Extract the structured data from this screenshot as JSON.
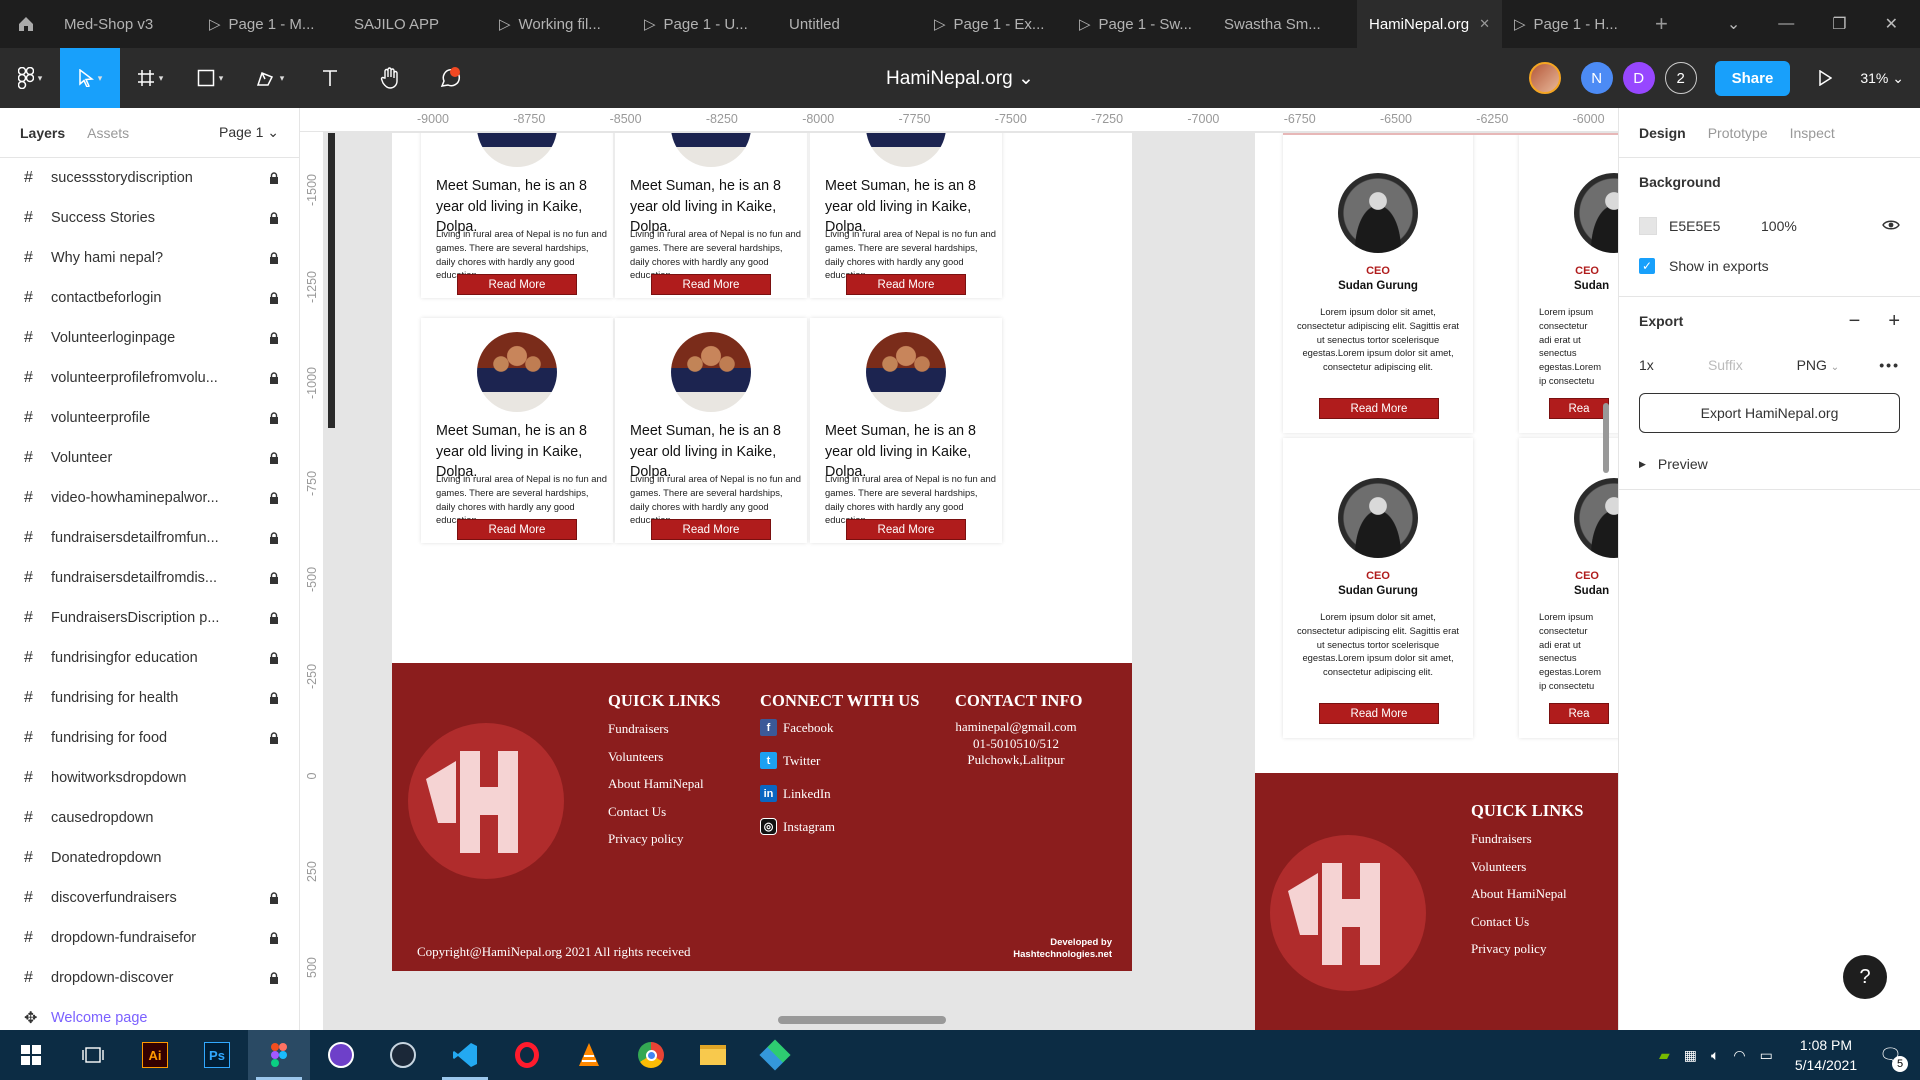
{
  "tabs": [
    {
      "label": "Med-Shop v3",
      "proto": false
    },
    {
      "label": "Page 1 - M...",
      "proto": true
    },
    {
      "label": "SAJILO APP",
      "proto": false
    },
    {
      "label": "Working fil...",
      "proto": true
    },
    {
      "label": "Page 1 - U...",
      "proto": true
    },
    {
      "label": "Untitled",
      "proto": false
    },
    {
      "label": "Page 1 - Ex...",
      "proto": true
    },
    {
      "label": "Page 1 - Sw...",
      "proto": true
    },
    {
      "label": "Swastha Sm...",
      "proto": false
    },
    {
      "label": "HamiNepal.org",
      "proto": false,
      "active": true
    },
    {
      "label": "Page 1 - H...",
      "proto": true
    }
  ],
  "file_title": "HamiNepal.org",
  "zoom": "31%",
  "collab_count": "2",
  "avatars": [
    {
      "letter": "N",
      "color": "#4c8bf5"
    },
    {
      "letter": "D",
      "color": "#9747ff"
    }
  ],
  "share_label": "Share",
  "left_panel": {
    "tab_layers": "Layers",
    "tab_assets": "Assets",
    "page": "Page 1"
  },
  "layers": [
    {
      "name": "sucessstorydiscription",
      "locked": true
    },
    {
      "name": "Success Stories",
      "locked": true
    },
    {
      "name": "Why hami nepal?",
      "locked": true
    },
    {
      "name": "contactbeforlogin",
      "locked": true
    },
    {
      "name": "Volunteerloginpage",
      "locked": true
    },
    {
      "name": "volunteerprofilefromvolu...",
      "locked": true
    },
    {
      "name": "volunteerprofile",
      "locked": true
    },
    {
      "name": "Volunteer",
      "locked": true
    },
    {
      "name": "video-howhaminepalwor...",
      "locked": true
    },
    {
      "name": "fundraisersdetailfromfun...",
      "locked": true
    },
    {
      "name": "fundraisersdetailfromdis...",
      "locked": true
    },
    {
      "name": "FundraisersDiscription p...",
      "locked": true
    },
    {
      "name": "fundrisingfor education",
      "locked": true
    },
    {
      "name": "fundrising for health",
      "locked": true
    },
    {
      "name": "fundrising for food",
      "locked": true
    },
    {
      "name": "howitworksdropdown",
      "locked": false
    },
    {
      "name": "causedropdown",
      "locked": false
    },
    {
      "name": "Donatedropdown",
      "locked": false
    },
    {
      "name": "discoverfundraisers",
      "locked": true
    },
    {
      "name": "dropdown-fundraisefor",
      "locked": true
    },
    {
      "name": "dropdown-discover",
      "locked": true
    }
  ],
  "welcome_page": "Welcome page",
  "ruler_x": [
    "-9000",
    "-8750",
    "-8500",
    "-8250",
    "-8000",
    "-7750",
    "-7500",
    "-7250",
    "-7000",
    "-6750",
    "-6500",
    "-6250",
    "-6000"
  ],
  "ruler_y": [
    "-1500",
    "-1250",
    "-1000",
    "-750",
    "-500",
    "-250",
    "0",
    "250",
    "500"
  ],
  "story_card": {
    "heading": "Meet Suman, he is an 8 year old living in Kaike, Dolpa.",
    "body": "Living in rural area of Nepal is no fun and games. There are several hardships, daily chores with hardly any good education",
    "button": "Read More"
  },
  "footer": {
    "quick_links_title": "QUICK LINKS",
    "quick_links": [
      "Fundraisers",
      "Volunteers",
      "About HamiNepal",
      "Contact Us",
      "Privacy policy"
    ],
    "connect_title": "CONNECT WITH US",
    "social": [
      {
        "label": "Facebook",
        "icon": "facebook-icon",
        "color": "#3b5998",
        "glyph": "f"
      },
      {
        "label": "Twitter",
        "icon": "twitter-icon",
        "color": "#1da1f2",
        "glyph": "t"
      },
      {
        "label": "LinkedIn",
        "icon": "linkedin-icon",
        "color": "#0a66c2",
        "glyph": "in"
      },
      {
        "label": "Instagram",
        "icon": "instagram-icon",
        "color": "#111111",
        "glyph": "◎"
      }
    ],
    "contact_title": "CONTACT INFO",
    "contact": [
      "haminepal@gmail.com",
      "01-5010510/512",
      "Pulchowk,Lalitpur"
    ],
    "copyright": "Copyright@HamiNepal.org 2021 All rights received",
    "developed_by": "Developed by",
    "developer": "Hashtechnologies.net"
  },
  "team_card": {
    "role": "CEO",
    "name": "Sudan Gurung",
    "desc": "Lorem ipsum dolor sit amet, consectetur adipiscing elit. Sagittis erat ut senectus tortor scelerisque egestas.Lorem ipsum dolor sit amet, consectetur adipiscing elit.",
    "button": "Read More",
    "name_partial": "Sudan",
    "desc_partial": "Lorem ipsum consectetur adi erat ut senectus egestas.Lorem ip consectetu",
    "button_partial": "Rea"
  },
  "right_panel": {
    "tabs": [
      "Design",
      "Prototype",
      "Inspect"
    ],
    "background_title": "Background",
    "bg_color": "E5E5E5",
    "bg_opacity": "100%",
    "show_in_exports": "Show in exports",
    "export_title": "Export",
    "export_scale": "1x",
    "export_suffix": "Suffix",
    "export_format": "PNG",
    "export_button": "Export HamiNepal.org",
    "preview": "Preview"
  },
  "help_label": "?",
  "taskbar": {
    "time": "1:08 PM",
    "date": "5/14/2021",
    "notifications": "5"
  },
  "colors": {
    "accent": "#18a0fb",
    "brand_red": "#8b1d1d",
    "button_red": "#b01c1c"
  }
}
